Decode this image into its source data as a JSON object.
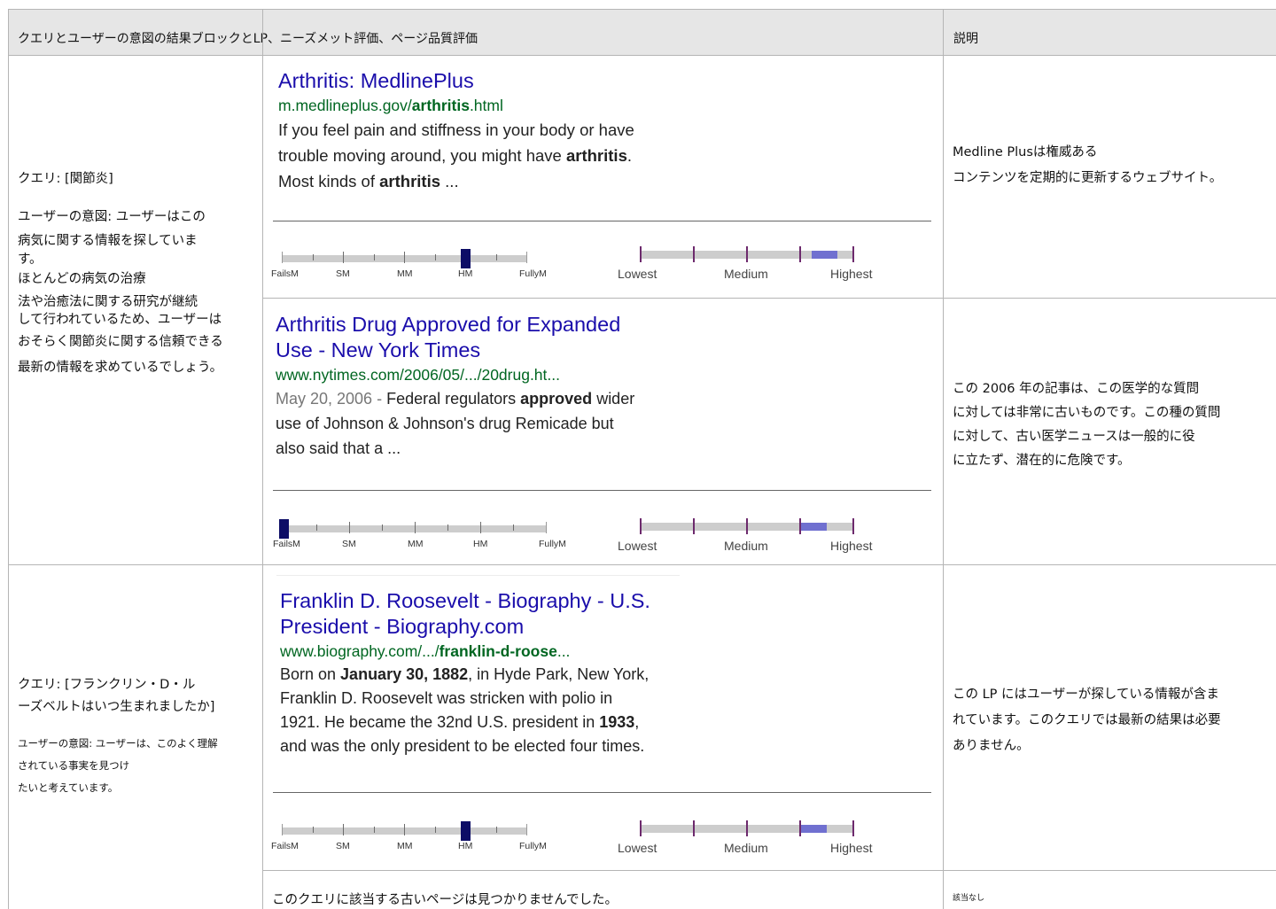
{
  "header": {
    "col1": "クエリとユーザーの意図の結果ブロックとLP、ニーズメット評価、ページ品質評価",
    "col2": "説明"
  },
  "scales": {
    "needs_met_labels": [
      "FailsM",
      "SM",
      "MM",
      "HM",
      "FullyM"
    ],
    "page_quality_labels": [
      "Lowest",
      "Medium",
      "Highest"
    ]
  },
  "colors": {
    "serp_title": "#1a0dab",
    "serp_url": "#006621",
    "needs_met_marker": "#0d0d66",
    "page_quality_fill": "#7070d0",
    "page_quality_tick": "#6d2a6d"
  },
  "queries": [
    {
      "query": "クエリ: [関節炎]",
      "intent_lines": [
        "ユーザーの意図: ユーザーはこの",
        "病気に関する情報を探していま",
        "す。",
        "ほとんどの病気の治療",
        "法や治癒法に関する研究が継続",
        "して行われているため、ユーザーは",
        "おそらく関節炎に関する信頼できる",
        "最新の情報を求めているでしょう。"
      ],
      "results": [
        {
          "title_lines": [
            "Arthritis: MedlinePlus"
          ],
          "url_pre": "m.medlineplus.gov/",
          "url_bold": "arthritis",
          "url_post": ".html",
          "snippet_lines": [
            [
              "If you feel pain and stiffness in your body or have"
            ],
            [
              "trouble moving around, you might have ",
              "arthritis",
              "."
            ],
            [
              "Most kinds of ",
              "arthritis",
              " ..."
            ]
          ],
          "needs_met": "HM",
          "page_quality": 0.87,
          "explanation_lines": [
            "Medline Plusは権威ある",
            "コンテンツを定期的に更新するウェブサイト。"
          ]
        },
        {
          "title_lines": [
            "Arthritis Drug Approved for Expanded",
            "Use - New York Times"
          ],
          "url_pre": "www.nytimes.com/2006/05/.../20drug.ht...",
          "url_bold": "",
          "url_post": "",
          "date": "May 20, 2006 - ",
          "snippet_lines": [
            [
              "Federal regulators ",
              "approved",
              " wider"
            ],
            [
              "use of Johnson & Johnson's drug Remicade but"
            ],
            [
              "also said that a ..."
            ]
          ],
          "needs_met": "FailsM",
          "page_quality": 0.82,
          "explanation_lines": [
            "この 2006 年の記事は、この医学的な質問",
            "に対しては非常に古いものです。この種の質問",
            "に対して、古い医学ニュースは一般的に役",
            "に立たず、潜在的に危険です。"
          ]
        }
      ]
    },
    {
      "query_lines": [
        "クエリ: [フランクリン・D・ル",
        "ーズベルトはいつ生まれましたか]"
      ],
      "intent_lines": [
        "ユーザーの意図: ユーザーは、このよく理解",
        "されている事実を見つけ",
        "たいと考えています。"
      ],
      "results": [
        {
          "title_lines": [
            "Franklin D. Roosevelt - Biography - U.S.",
            "President - Biography.com"
          ],
          "url_pre": "www.biography.com/.../",
          "url_bold": "franklin-d-roose",
          "url_post": "...",
          "snippet_lines": [
            [
              "Born on ",
              "January 30, 1882",
              ", in Hyde Park, New York,"
            ],
            [
              "Franklin D. Roosevelt was stricken with polio in"
            ],
            [
              "1921. He became the 32nd U.S. president in ",
              "1933",
              ","
            ],
            [
              "and was the only president to be elected four times."
            ]
          ],
          "needs_met": "HM",
          "page_quality": 0.82,
          "explanation_lines": [
            "この LP にはユーザーが探している情報が含ま",
            "れています。このクエリでは最新の結果は必要",
            "ありません。"
          ]
        }
      ],
      "no_page": "このクエリに該当する古いページは見つかりませんでした。",
      "no_page_explanation": "該当なし"
    }
  ]
}
